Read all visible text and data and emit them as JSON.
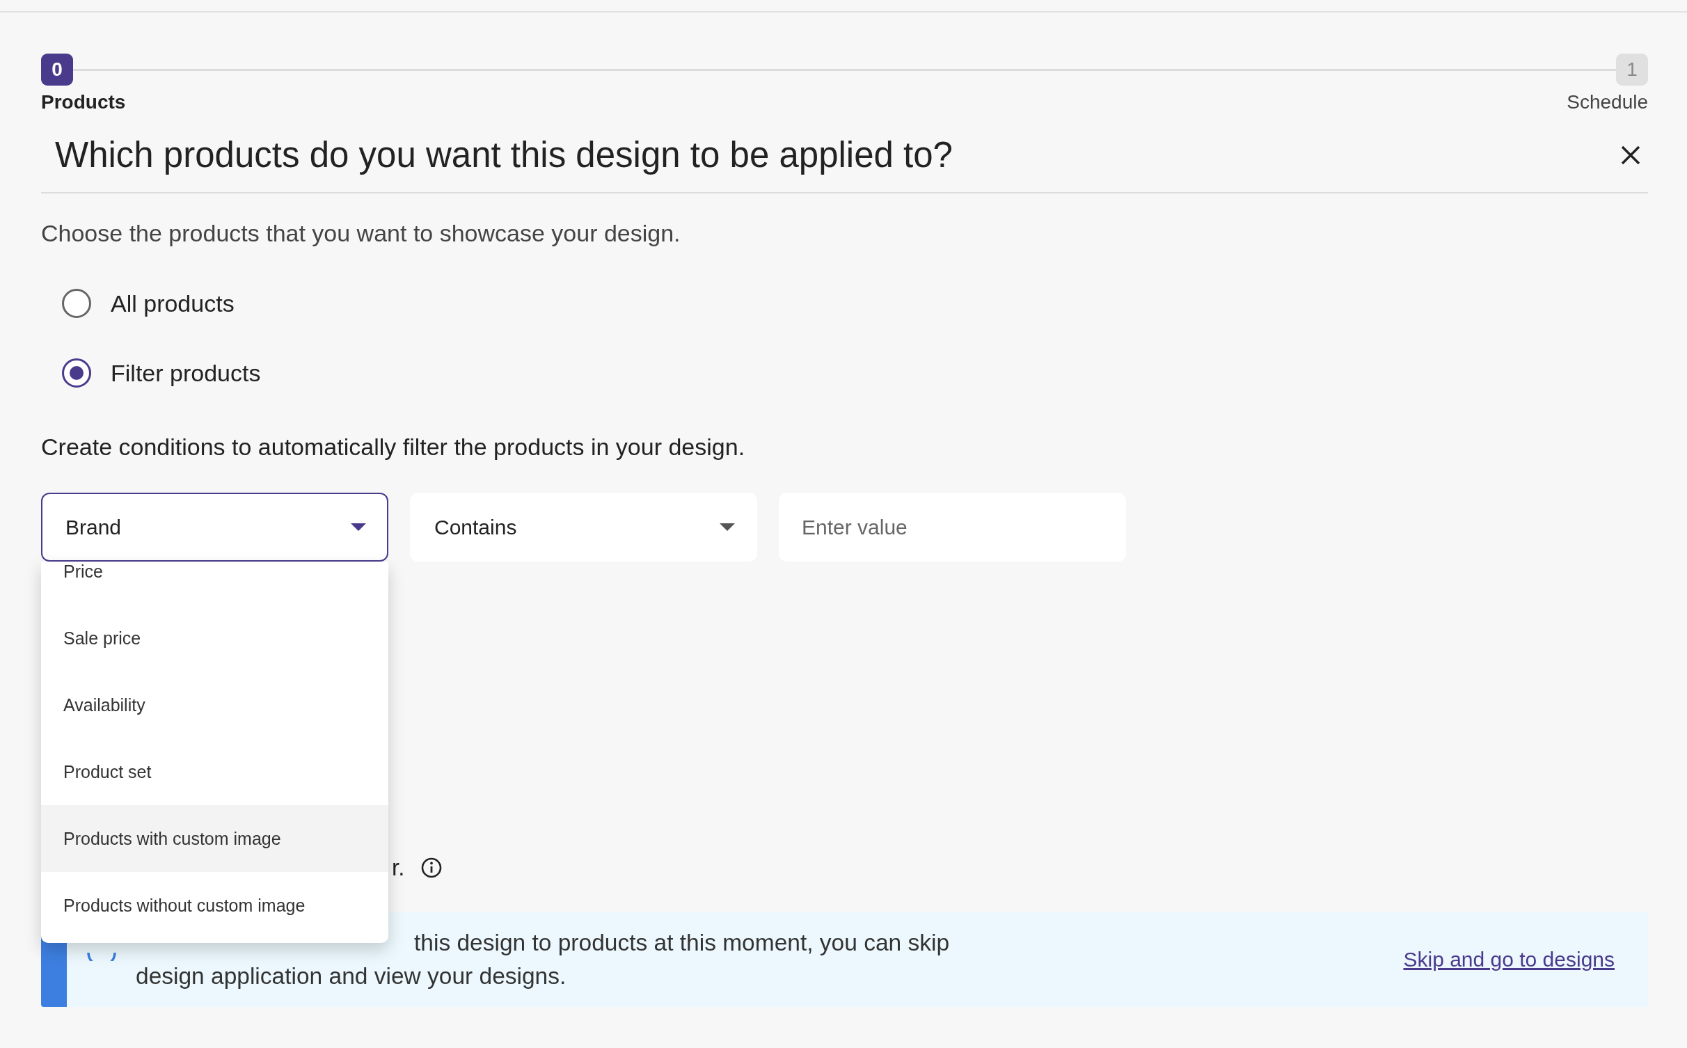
{
  "stepper": {
    "steps": [
      {
        "number": "0",
        "label": "Products",
        "selected": true
      },
      {
        "number": "1",
        "label": "Schedule",
        "selected": false
      }
    ]
  },
  "heading": "Which products do you want this design to be applied to?",
  "subtitle": "Choose the products that you want to showcase your design.",
  "options": [
    {
      "label": "All products",
      "selected": false
    },
    {
      "label": "Filter products",
      "selected": true
    }
  ],
  "conditions_intro": "Create conditions to automatically filter the products in your design.",
  "filter": {
    "field": {
      "value": "Brand",
      "expanded": true
    },
    "operator": {
      "value": "Contains"
    },
    "input": {
      "placeholder": "Enter value"
    }
  },
  "field_menu": [
    {
      "label": "Price",
      "highlighted": false
    },
    {
      "label": "Sale price",
      "highlighted": false
    },
    {
      "label": "Availability",
      "highlighted": false
    },
    {
      "label": "Product set",
      "highlighted": false
    },
    {
      "label": "Products with custom image",
      "highlighted": true
    },
    {
      "label": "Products without custom image",
      "highlighted": false
    }
  ],
  "note_fragment": "r.",
  "banner": {
    "line_1": "this design to products at this moment, you can skip",
    "line_2": "design application and view your designs.",
    "link": "Skip and go to designs"
  }
}
